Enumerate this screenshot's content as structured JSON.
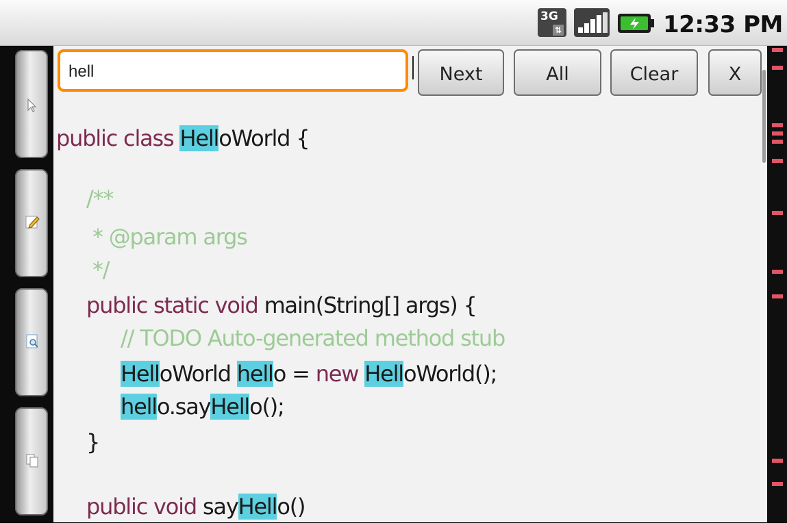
{
  "status_bar": {
    "network_label": "3G",
    "time": "12:33 PM"
  },
  "search": {
    "value": "hell"
  },
  "buttons": {
    "next": "Next",
    "all": "All",
    "clear": "Clear",
    "close": "X"
  },
  "code": {
    "l1_kw": "public class ",
    "l1_hl": "Hell",
    "l1_rest": "oWorld {",
    "l2": "/**",
    "l3": " * @param args",
    "l4": " */",
    "l5_kw": "public static void",
    "l5_rest": " main(String[] args) {",
    "l6": "// TODO Auto-generated method stub",
    "l7_hl1": "Hell",
    "l7_t1": "oWorld ",
    "l7_hl2": "hell",
    "l7_t2": "o = ",
    "l7_kw": "new",
    "l7_t3": " ",
    "l7_hl3": "Hell",
    "l7_t4": "oWorld();",
    "l8_hl1": "hell",
    "l8_t1": "o.say",
    "l8_hl2": "Hell",
    "l8_t2": "o();",
    "l9": "}",
    "l10_kw": "public void",
    "l10_t1": " say",
    "l10_hl": "Hell",
    "l10_t2": "o()"
  },
  "colors": {
    "keyword": "#7d2a50",
    "comment": "#9ccb95",
    "highlight": "#5ccfe0",
    "search_focus": "#ff8a00",
    "match_marker": "#e25566"
  },
  "icons": [
    "pointer-icon",
    "pencil-icon",
    "document-search-icon",
    "copy-icon",
    "3g-icon",
    "signal-icon",
    "battery-icon"
  ]
}
